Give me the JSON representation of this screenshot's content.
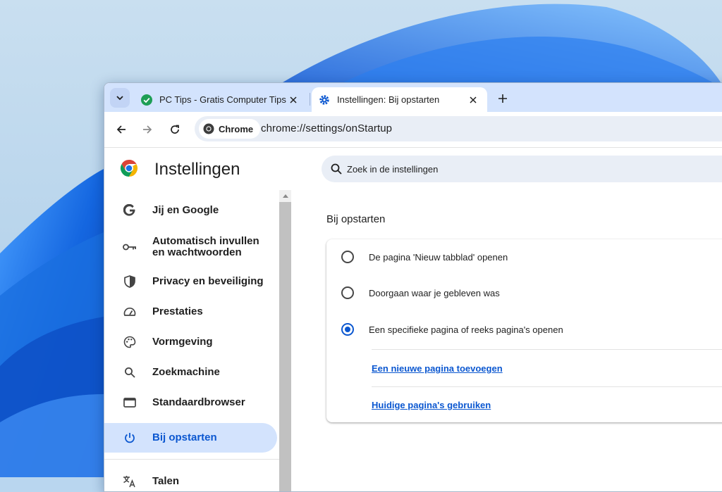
{
  "tabs": [
    {
      "title": "PC Tips - Gratis Computer Tips.",
      "active": false,
      "favicon": "green-check-icon"
    },
    {
      "title": "Instellingen: Bij opstarten",
      "active": true,
      "favicon": "gear-icon"
    }
  ],
  "omnibox": {
    "chip_label": "Chrome",
    "url": "chrome://settings/onStartup"
  },
  "settings": {
    "title": "Instellingen",
    "search_placeholder": "Zoek in de instellingen",
    "nav": [
      {
        "label": "Jij en Google",
        "icon": "google-g-icon"
      },
      {
        "label": "Automatisch invullen en wachtwoorden",
        "icon": "key-icon"
      },
      {
        "label": "Privacy en beveiliging",
        "icon": "shield-icon"
      },
      {
        "label": "Prestaties",
        "icon": "speedometer-icon"
      },
      {
        "label": "Vormgeving",
        "icon": "palette-icon"
      },
      {
        "label": "Zoekmachine",
        "icon": "search-icon"
      },
      {
        "label": "Standaardbrowser",
        "icon": "browser-window-icon"
      },
      {
        "label": "Bij opstarten",
        "icon": "power-icon",
        "selected": true
      },
      {
        "label": "Talen",
        "icon": "translate-icon"
      }
    ],
    "section_title": "Bij opstarten",
    "startup_options": [
      {
        "label": "De pagina 'Nieuw tabblad' openen",
        "checked": false
      },
      {
        "label": "Doorgaan waar je gebleven was",
        "checked": false
      },
      {
        "label": "Een specifieke pagina of reeks pagina's openen",
        "checked": true
      }
    ],
    "links": {
      "add_page": "Een nieuwe pagina toevoegen",
      "use_current": "Huidige pagina's gebruiken"
    }
  },
  "colors": {
    "accent": "#0b57d0",
    "tabstrip": "#d3e3fd",
    "selected_nav_bg": "#d3e3fd",
    "wallpaper_blue": "#1a6fe0"
  }
}
